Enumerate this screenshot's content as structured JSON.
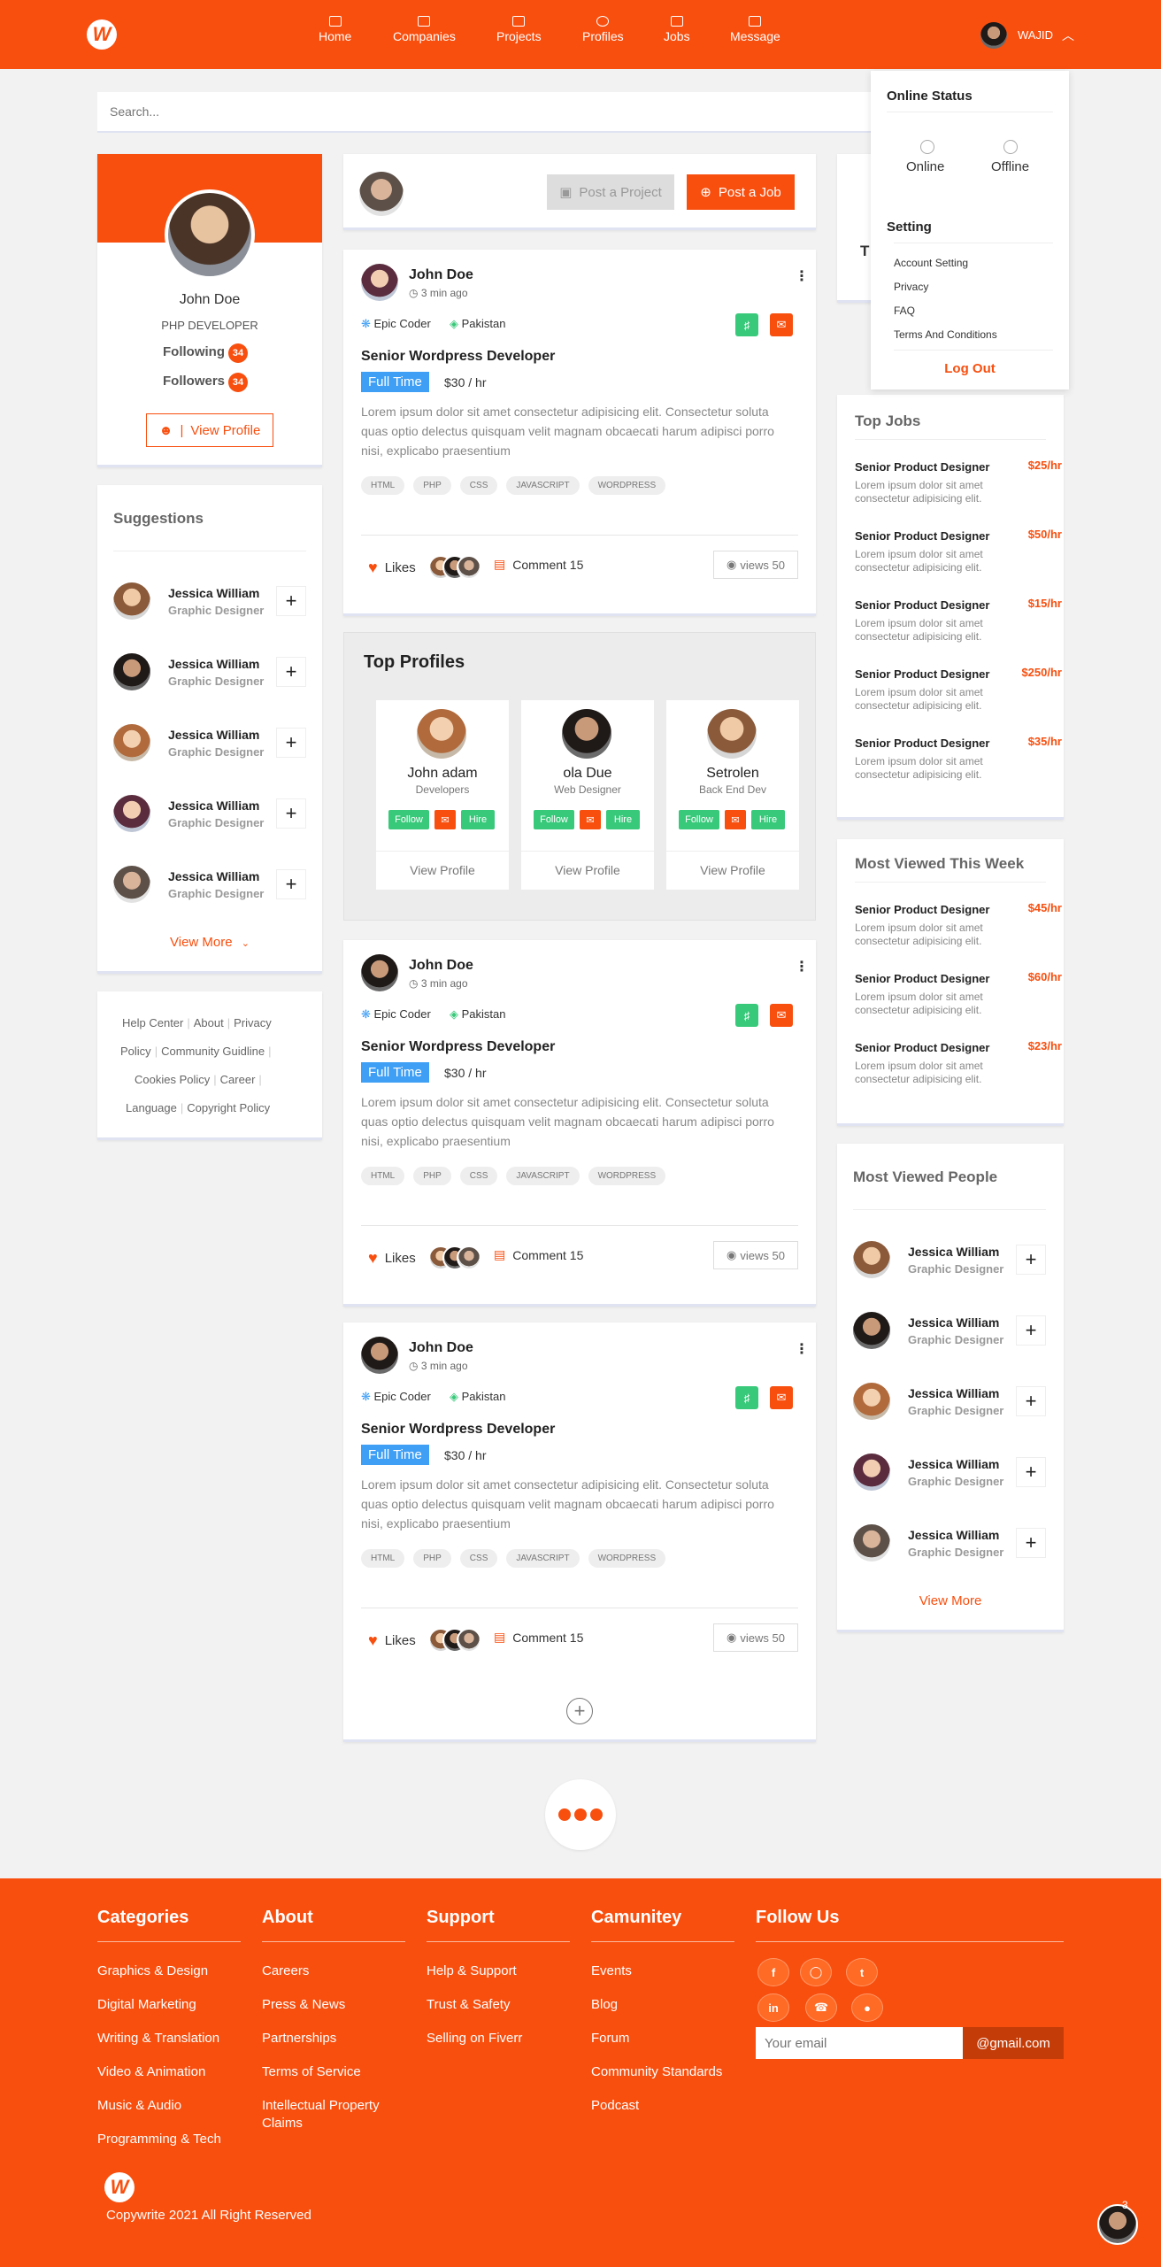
{
  "header": {
    "nav": [
      "Home",
      "Companies",
      "Projects",
      "Profiles",
      "Jobs",
      "Message"
    ],
    "user_name": "WAJID"
  },
  "search": {
    "placeholder": "Search..."
  },
  "status_menu": {
    "title": "Online Status",
    "online": "Online",
    "offline": "Offline",
    "setting_title": "Setting",
    "items": [
      "Account Setting",
      "Privacy",
      "FAQ",
      "Terms And Conditions"
    ],
    "logout": "Log Out"
  },
  "profile": {
    "name": "John Doe",
    "role": "PHP DEVELOPER",
    "following_label": "Following",
    "following_count": "34",
    "followers_label": "Followers",
    "followers_count": "34",
    "view_profile": "View Profile"
  },
  "suggestions": {
    "title": "Suggestions",
    "people": [
      {
        "name": "Jessica William",
        "role": "Graphic Designer"
      },
      {
        "name": "Jessica William",
        "role": "Graphic Designer"
      },
      {
        "name": "Jessica William",
        "role": "Graphic Designer"
      },
      {
        "name": "Jessica William",
        "role": "Graphic Designer"
      },
      {
        "name": "Jessica William",
        "role": "Graphic Designer"
      }
    ],
    "view_more": "View More"
  },
  "links": [
    "Help Center",
    "About",
    "Privacy",
    "Policy",
    "Community Guidline",
    "Cookies Policy",
    "Career",
    "Language",
    "Copyright Policy"
  ],
  "composer": {
    "post_project": "Post a Project",
    "post_job": "Post a Job"
  },
  "posts": [
    {
      "author": "John Doe",
      "time": "3 min ago",
      "company": "Epic Coder",
      "location": "Pakistan",
      "title": "Senior Wordpress Developer",
      "type": "Full Time",
      "rate": "$30 / hr",
      "body": "Lorem ipsum dolor sit amet consectetur adipisicing elit. Consectetur soluta quas optio delectus quisquam velit magnam obcaecati harum adipisci porro nisi, explicabo praesentium",
      "tags": [
        "HTML",
        "PHP",
        "CSS",
        "JAVASCRIPT",
        "WORDPRESS"
      ],
      "likes": "Likes",
      "comment": "Comment 15",
      "views": "views 50"
    },
    {
      "author": "John Doe",
      "time": "3 min ago",
      "company": "Epic Coder",
      "location": "Pakistan",
      "title": "Senior Wordpress Developer",
      "type": "Full Time",
      "rate": "$30 / hr",
      "body": "Lorem ipsum dolor sit amet consectetur adipisicing elit. Consectetur soluta quas optio delectus quisquam velit magnam obcaecati harum adipisci porro nisi, explicabo praesentium",
      "tags": [
        "HTML",
        "PHP",
        "CSS",
        "JAVASCRIPT",
        "WORDPRESS"
      ],
      "likes": "Likes",
      "comment": "Comment 15",
      "views": "views 50"
    },
    {
      "author": "John Doe",
      "time": "3 min ago",
      "company": "Epic Coder",
      "location": "Pakistan",
      "title": "Senior Wordpress Developer",
      "type": "Full Time",
      "rate": "$30 / hr",
      "body": "Lorem ipsum dolor sit amet consectetur adipisicing elit. Consectetur soluta quas optio delectus quisquam velit magnam obcaecati harum adipisci porro nisi, explicabo praesentium",
      "tags": [
        "HTML",
        "PHP",
        "CSS",
        "JAVASCRIPT",
        "WORDPRESS"
      ],
      "likes": "Likes",
      "comment": "Comment 15",
      "views": "views 50"
    }
  ],
  "top_profiles": {
    "title": "Top Profiles",
    "people": [
      {
        "name": "John adam",
        "role": "Developers"
      },
      {
        "name": "ola Due",
        "role": "Web Designer"
      },
      {
        "name": "Setrolen",
        "role": "Back End Dev"
      }
    ],
    "follow": "Follow",
    "hire": "Hire",
    "view_profile": "View Profile"
  },
  "top_jobs": {
    "title": "Top Jobs",
    "jobs": [
      {
        "title": "Senior Product Designer",
        "rate": "$25/hr",
        "desc": "Lorem ipsum dolor sit amet consectetur adipisicing elit."
      },
      {
        "title": "Senior Product Designer",
        "rate": "$50/hr",
        "desc": "Lorem ipsum dolor sit amet consectetur adipisicing elit."
      },
      {
        "title": "Senior Product Designer",
        "rate": "$15/hr",
        "desc": "Lorem ipsum dolor sit amet consectetur adipisicing elit."
      },
      {
        "title": "Senior Product Designer",
        "rate": "$250/hr",
        "desc": "Lorem ipsum dolor sit amet consectetur adipisicing elit."
      },
      {
        "title": "Senior Product Designer",
        "rate": "$35/hr",
        "desc": "Lorem ipsum dolor sit amet consectetur adipisicing elit."
      }
    ]
  },
  "most_viewed_week": {
    "title": "Most Viewed This Week",
    "jobs": [
      {
        "title": "Senior Product Designer",
        "rate": "$45/hr",
        "desc": "Lorem ipsum dolor sit amet consectetur adipisicing elit."
      },
      {
        "title": "Senior Product Designer",
        "rate": "$60/hr",
        "desc": "Lorem ipsum dolor sit amet consectetur adipisicing elit."
      },
      {
        "title": "Senior Product Designer",
        "rate": "$23/hr",
        "desc": "Lorem ipsum dolor sit amet consectetur adipisicing elit."
      }
    ]
  },
  "most_viewed_people": {
    "title": "Most Viewed People",
    "people": [
      {
        "name": "Jessica William",
        "role": "Graphic Designer"
      },
      {
        "name": "Jessica William",
        "role": "Graphic Designer"
      },
      {
        "name": "Jessica William",
        "role": "Graphic Designer"
      },
      {
        "name": "Jessica William",
        "role": "Graphic Designer"
      },
      {
        "name": "Jessica William",
        "role": "Graphic Designer"
      }
    ],
    "view_more": "View More"
  },
  "footer": {
    "categories": {
      "title": "Categories",
      "items": [
        "Graphics & Design",
        "Digital Marketing",
        "Writing & Translation",
        "Video & Animation",
        "Music & Audio",
        "Programming & Tech"
      ]
    },
    "about": {
      "title": "About",
      "items": [
        "Careers",
        "Press & News",
        "Partnerships",
        "Terms of Service",
        "Intellectual Property Claims"
      ]
    },
    "support": {
      "title": "Support",
      "items": [
        "Help & Support",
        "Trust & Safety",
        "Selling on Fiverr"
      ]
    },
    "community": {
      "title": "Camunitey",
      "items": [
        "Events",
        "Blog",
        "Forum",
        "Community Standards",
        "Podcast"
      ]
    },
    "follow": {
      "title": "Follow Us",
      "email_placeholder": "Your email",
      "email_button": "@gmail.com"
    },
    "copyright": "Copywrite 2021 All Right Reserved",
    "chat_count": "3"
  },
  "colors": {
    "accent": "#f84f0f",
    "green": "#39c97b",
    "blue": "#3f9ff5"
  }
}
